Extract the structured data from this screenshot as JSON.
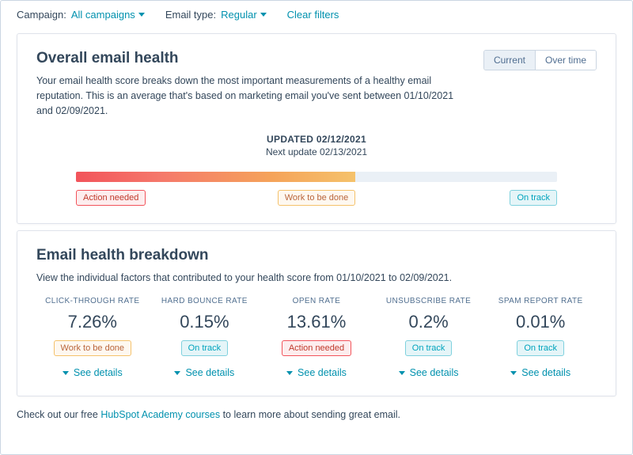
{
  "filters": {
    "campaign_label": "Campaign:",
    "campaign_value": "All campaigns",
    "email_type_label": "Email type:",
    "email_type_value": "Regular",
    "clear": "Clear filters"
  },
  "overall": {
    "title": "Overall email health",
    "desc": "Your email health score breaks down the most important measurements of a healthy email reputation. This is an average that's based on marketing email you've sent between 01/10/2021 and 02/09/2021.",
    "tabs": {
      "current": "Current",
      "over_time": "Over time"
    },
    "updated_label": "UPDATED 02/12/2021",
    "next_update": "Next update 02/13/2021",
    "scale": {
      "action": "Action needed",
      "work": "Work to be done",
      "track": "On track"
    }
  },
  "breakdown": {
    "title": "Email health breakdown",
    "desc": "View the individual factors that contributed to your health score from 01/10/2021 to 02/09/2021.",
    "see_details": "See details",
    "metrics": [
      {
        "label": "CLICK-THROUGH RATE",
        "value": "7.26%",
        "status": "Work to be done",
        "status_class": "tag-orange"
      },
      {
        "label": "HARD BOUNCE RATE",
        "value": "0.15%",
        "status": "On track",
        "status_class": "tag-teal"
      },
      {
        "label": "OPEN RATE",
        "value": "13.61%",
        "status": "Action needed",
        "status_class": "tag-red"
      },
      {
        "label": "UNSUBSCRIBE RATE",
        "value": "0.2%",
        "status": "On track",
        "status_class": "tag-teal"
      },
      {
        "label": "SPAM REPORT RATE",
        "value": "0.01%",
        "status": "On track",
        "status_class": "tag-teal"
      }
    ]
  },
  "footer": {
    "pre": "Check out our free ",
    "link": "HubSpot Academy courses",
    "post": " to learn more about sending great email."
  }
}
